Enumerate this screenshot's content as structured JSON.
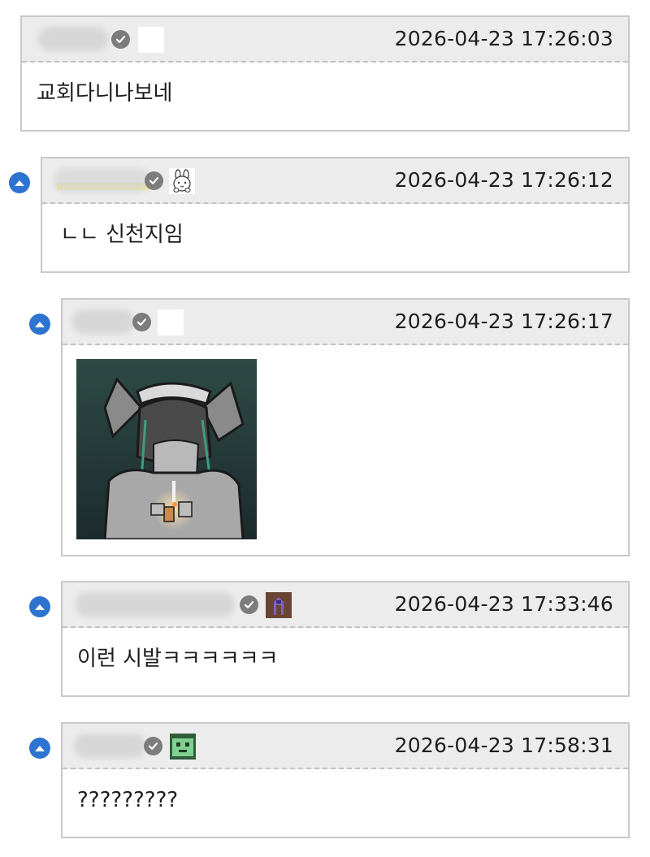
{
  "comments": [
    {
      "timestamp": "2026-04-23 17:26:03",
      "text": "교회다니나보네",
      "badge": "white",
      "reply": false
    },
    {
      "timestamp": "2026-04-23 17:26:12",
      "text": "ㄴㄴ 신천지임",
      "badge": "bunny-sticker",
      "reply": true
    },
    {
      "timestamp": "2026-04-23 17:26:17",
      "text": "",
      "attachment": "pixel-art-image",
      "badge": "white",
      "reply": true
    },
    {
      "timestamp": "2026-04-23 17:33:46",
      "text": "이런 시발ㅋㅋㅋㅋㅋㅋ",
      "badge": "brown-pixel",
      "reply": true
    },
    {
      "timestamp": "2026-04-23 17:58:31",
      "text": "?????????",
      "badge": "green-pixel",
      "reply": true
    }
  ],
  "icons": {
    "verified": "verified-check-icon",
    "reply": "reply-up-arrow-icon"
  },
  "colors": {
    "reply_blue": "#2f73d0",
    "verified_grey": "#7c7c7c",
    "header_bg": "#ececec",
    "border": "#c8c8c8"
  }
}
